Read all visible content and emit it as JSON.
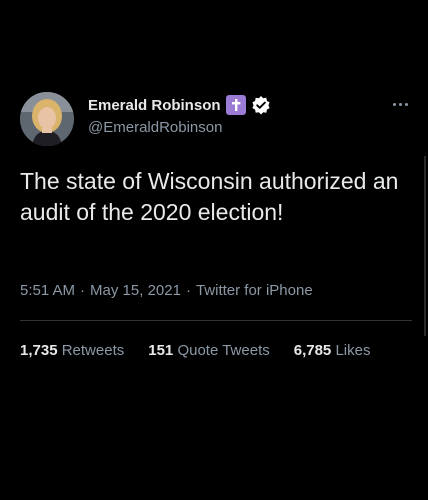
{
  "author": {
    "display_name": "Emerald Robinson",
    "handle": "@EmeraldRobinson",
    "avatar_icon": "profile-photo",
    "badges": [
      "cross-icon",
      "verified-icon"
    ]
  },
  "tweet": {
    "text": "The state of Wisconsin authorized an audit of the 2020 election!",
    "time": "5:51 AM",
    "date": "May 15, 2021",
    "separator": "·",
    "source": "Twitter for iPhone"
  },
  "stats": {
    "retweets_count": "1,735",
    "retweets_label": "Retweets",
    "quotes_count": "151",
    "quotes_label": "Quote Tweets",
    "likes_count": "6,785",
    "likes_label": "Likes"
  },
  "colors": {
    "background": "#000000",
    "primary_text": "#e7e9ea",
    "secondary_text": "#8b98a5",
    "divider": "#2f3336",
    "cross_badge": "#9c7bd6",
    "verified_badge": "#ffffff"
  }
}
